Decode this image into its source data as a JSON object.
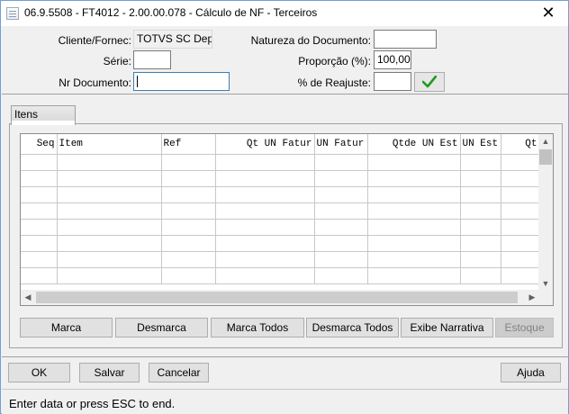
{
  "window": {
    "title": "06.9.5508 - FT4012 - 2.00.00.078 - Cálculo de NF - Terceiros",
    "close_glyph": "✕"
  },
  "form": {
    "cliente_label": "Cliente/Fornec:",
    "cliente_value": "TOTVS SC Dep",
    "serie_label": "Série:",
    "serie_value": "",
    "nr_documento_label": "Nr Documento:",
    "nr_documento_value": "",
    "natureza_label": "Natureza do Documento:",
    "natureza_value": "",
    "proporcao_label": "Proporção (%):",
    "proporcao_value": "100,00",
    "reajuste_label": "% de Reajuste:",
    "reajuste_value": "",
    "confirm_icon": "checkmark-icon",
    "confirm_color": "#1f9b1f"
  },
  "tabs": [
    {
      "label": "Itens"
    }
  ],
  "grid": {
    "columns": [
      "Seq",
      "Item",
      "Ref",
      "Qt UN Fatur",
      "UN Fatur",
      "Qtde UN Est",
      "UN Est",
      "Qt"
    ],
    "empty_rows": 8
  },
  "grid_buttons": {
    "marca": "Marca",
    "desmarca": "Desmarca",
    "marca_todos": "Marca Todos",
    "desmarca_todos": "Desmarca Todos",
    "exibe_narrativa": "Exibe Narrativa",
    "estoque": "Estoque"
  },
  "footer_buttons": {
    "ok": "OK",
    "salvar": "Salvar",
    "cancelar": "Cancelar",
    "ajuda": "Ajuda"
  },
  "status": {
    "message": "Enter data or press ESC to end."
  }
}
